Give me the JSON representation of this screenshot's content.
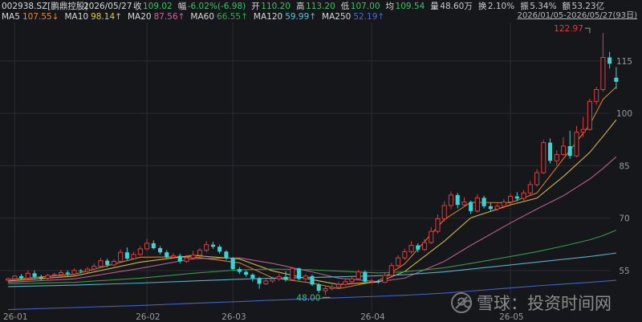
{
  "header": {
    "symbol": "002938.SZ[鹏鼎控股]",
    "date": "2026/05/27",
    "range": "2026/01/05-2026/05/27(93日)",
    "stats": [
      {
        "label": "收",
        "value": "109.02",
        "color": "#3cc06a"
      },
      {
        "label": "幅",
        "value": "-6.02%(-6.98)",
        "color": "#3cc06a"
      },
      {
        "label": "开",
        "value": "110.20",
        "color": "#3cc06a"
      },
      {
        "label": "高",
        "value": "113.20",
        "color": "#3cc06a"
      },
      {
        "label": "低",
        "value": "107.00",
        "color": "#3cc06a"
      },
      {
        "label": "均",
        "value": "109.54",
        "color": "#3cc06a"
      },
      {
        "label": "量",
        "value": "48.60万",
        "color": "#c8c8c8"
      },
      {
        "label": "换",
        "value": "2.10%",
        "color": "#c8c8c8"
      },
      {
        "label": "振",
        "value": "5.34%",
        "color": "#c8c8c8"
      },
      {
        "label": "额",
        "value": "53.23亿",
        "color": "#c8c8c8"
      }
    ],
    "ma_legend": [
      {
        "label": "MA5",
        "value": "107.55↓",
        "color": "#e8892f"
      },
      {
        "label": "MA10",
        "value": "98.14↑",
        "color": "#e2c94a"
      },
      {
        "label": "MA20",
        "value": "87.56↑",
        "color": "#c8669a"
      },
      {
        "label": "MA60",
        "value": "66.55↑",
        "color": "#3aa64e"
      },
      {
        "label": "MA120",
        "value": "59.99↑",
        "color": "#5dc0d8"
      },
      {
        "label": "MA250",
        "value": "52.19↑",
        "color": "#4a6ad8"
      }
    ]
  },
  "watermark": {
    "text": "雪球：投资时间网"
  },
  "colors": {
    "up": "#e03b3b",
    "down": "#3ad4d4",
    "grid": "#2a2c31",
    "axis_text": "#9a9a9a"
  },
  "chart_data": {
    "type": "candlestick",
    "y_ticks": [
      55,
      70,
      85,
      100,
      115
    ],
    "ylim": [
      46,
      126
    ],
    "x_tick_labels": [
      {
        "label": "26-01",
        "index": 1
      },
      {
        "label": "26-02",
        "index": 21
      },
      {
        "label": "26-03",
        "index": 34
      },
      {
        "label": "26-04",
        "index": 55
      },
      {
        "label": "26-05",
        "index": 76
      }
    ],
    "annotations": [
      {
        "text": "122.97",
        "index": 88,
        "value": 122.97,
        "color": "#e03b3b"
      },
      {
        "text": "48.00",
        "index": 48,
        "value": 48.0,
        "color": "#3cc06a"
      }
    ],
    "candles": [
      [
        52.2,
        52.6,
        53.0,
        51.6
      ],
      [
        52.6,
        53.4,
        53.6,
        52.2
      ],
      [
        53.4,
        52.8,
        54.0,
        52.4
      ],
      [
        52.8,
        54.2,
        55.0,
        52.6
      ],
      [
        54.2,
        53.2,
        55.0,
        52.8
      ],
      [
        53.2,
        52.8,
        53.8,
        52.2
      ],
      [
        52.8,
        53.6,
        54.0,
        52.4
      ],
      [
        53.6,
        53.8,
        54.4,
        53.0
      ],
      [
        53.8,
        54.4,
        55.2,
        53.2
      ],
      [
        54.4,
        54.0,
        55.0,
        53.4
      ],
      [
        54.0,
        55.0,
        55.6,
        53.6
      ],
      [
        55.0,
        54.8,
        55.4,
        54.2
      ],
      [
        54.8,
        55.4,
        56.0,
        54.4
      ],
      [
        55.4,
        56.2,
        57.0,
        55.0
      ],
      [
        56.2,
        57.8,
        58.6,
        55.8
      ],
      [
        57.8,
        56.6,
        58.4,
        56.0
      ],
      [
        56.6,
        57.6,
        58.2,
        56.2
      ],
      [
        57.6,
        60.2,
        61.0,
        57.4
      ],
      [
        60.2,
        58.4,
        61.6,
        58.0
      ],
      [
        58.4,
        59.6,
        60.4,
        58.0
      ],
      [
        59.6,
        61.2,
        62.0,
        59.2
      ],
      [
        61.2,
        62.8,
        64.0,
        60.8
      ],
      [
        62.8,
        61.4,
        63.6,
        61.0
      ],
      [
        61.4,
        60.2,
        62.0,
        59.6
      ],
      [
        60.2,
        58.8,
        60.8,
        58.2
      ],
      [
        58.8,
        59.2,
        60.0,
        58.4
      ],
      [
        59.2,
        57.6,
        59.8,
        57.0
      ],
      [
        57.6,
        58.6,
        59.4,
        57.2
      ],
      [
        58.6,
        59.4,
        60.6,
        58.0
      ],
      [
        59.4,
        60.8,
        61.4,
        58.8
      ],
      [
        60.8,
        62.4,
        63.4,
        60.2
      ],
      [
        62.4,
        61.8,
        63.2,
        61.2
      ],
      [
        61.8,
        60.4,
        62.4,
        59.8
      ],
      [
        60.4,
        58.6,
        60.8,
        58.0
      ],
      [
        58.6,
        55.4,
        58.8,
        55.0
      ],
      [
        55.4,
        54.6,
        56.0,
        54.0
      ],
      [
        54.6,
        53.8,
        55.0,
        53.2
      ],
      [
        53.8,
        52.8,
        54.2,
        51.8
      ],
      [
        52.8,
        51.2,
        53.2,
        49.8
      ],
      [
        51.2,
        52.0,
        52.6,
        50.8
      ],
      [
        52.0,
        52.6,
        53.2,
        51.4
      ],
      [
        52.6,
        53.2,
        54.0,
        52.0
      ],
      [
        53.2,
        52.4,
        54.8,
        51.8
      ],
      [
        52.4,
        55.6,
        56.0,
        52.2
      ],
      [
        55.6,
        52.6,
        55.8,
        52.2
      ],
      [
        52.6,
        53.4,
        54.0,
        52.0
      ],
      [
        53.4,
        51.0,
        53.8,
        50.6
      ],
      [
        51.0,
        49.2,
        51.4,
        48.6
      ],
      [
        49.2,
        49.8,
        50.4,
        48.0
      ],
      [
        49.8,
        50.2,
        51.0,
        49.2
      ],
      [
        50.2,
        51.0,
        51.8,
        49.8
      ],
      [
        51.0,
        51.8,
        52.4,
        50.6
      ],
      [
        51.8,
        52.6,
        53.2,
        51.2
      ],
      [
        52.6,
        54.6,
        55.2,
        52.2
      ],
      [
        54.6,
        51.8,
        55.0,
        51.4
      ],
      [
        51.8,
        52.0,
        52.6,
        51.4
      ],
      [
        52.0,
        51.6,
        52.4,
        51.2
      ],
      [
        51.6,
        53.6,
        54.4,
        51.4
      ],
      [
        53.6,
        56.4,
        57.2,
        53.2
      ],
      [
        56.4,
        58.6,
        59.4,
        56.0
      ],
      [
        58.6,
        60.4,
        61.2,
        58.0
      ],
      [
        60.4,
        62.2,
        63.4,
        59.8
      ],
      [
        62.2,
        61.0,
        62.8,
        60.2
      ],
      [
        61.0,
        63.0,
        64.0,
        60.6
      ],
      [
        63.0,
        66.2,
        67.4,
        62.6
      ],
      [
        66.2,
        69.8,
        71.0,
        65.6
      ],
      [
        69.8,
        73.6,
        74.8,
        69.0
      ],
      [
        73.6,
        76.6,
        77.6,
        72.6
      ],
      [
        76.6,
        73.8,
        77.2,
        72.8
      ],
      [
        73.8,
        74.6,
        76.0,
        73.2
      ],
      [
        74.6,
        72.0,
        75.0,
        71.2
      ],
      [
        72.0,
        75.8,
        76.8,
        71.6
      ],
      [
        75.8,
        73.4,
        76.4,
        72.8
      ],
      [
        73.4,
        72.6,
        74.4,
        71.8
      ],
      [
        72.6,
        73.4,
        74.2,
        72.0
      ],
      [
        73.4,
        74.6,
        75.4,
        72.8
      ],
      [
        74.6,
        76.2,
        77.0,
        74.0
      ],
      [
        76.2,
        75.6,
        77.4,
        74.8
      ],
      [
        75.6,
        77.2,
        78.0,
        75.0
      ],
      [
        77.2,
        79.6,
        80.6,
        76.6
      ],
      [
        79.6,
        83.0,
        84.0,
        79.0
      ],
      [
        83.0,
        91.6,
        92.4,
        82.6
      ],
      [
        91.6,
        86.4,
        92.8,
        85.6
      ],
      [
        86.4,
        88.2,
        89.4,
        85.2
      ],
      [
        88.2,
        90.6,
        93.2,
        87.8
      ],
      [
        90.6,
        87.8,
        95.0,
        87.0
      ],
      [
        87.8,
        94.6,
        96.4,
        87.4
      ],
      [
        94.6,
        95.4,
        99.0,
        93.2
      ],
      [
        95.4,
        103.4,
        104.2,
        95.0
      ],
      [
        103.4,
        106.8,
        107.6,
        102.4
      ],
      [
        106.8,
        116.0,
        122.97,
        106.2
      ],
      [
        116.0,
        114.2,
        117.6,
        112.8
      ],
      [
        110.2,
        109.02,
        113.2,
        107.0
      ]
    ],
    "ma_lines": [
      {
        "name": "MA5",
        "color": "#e8892f",
        "values": [
          [
            0,
            52.4
          ],
          [
            10,
            53.9
          ],
          [
            20,
            58.8
          ],
          [
            28,
            58.9
          ],
          [
            35,
            57.2
          ],
          [
            40,
            52.9
          ],
          [
            46,
            51.4
          ],
          [
            50,
            49.8
          ],
          [
            56,
            52.0
          ],
          [
            60,
            56.9
          ],
          [
            66,
            69.6
          ],
          [
            70,
            74.5
          ],
          [
            76,
            74.4
          ],
          [
            80,
            77.2
          ],
          [
            84,
            87.0
          ],
          [
            88,
            96.7
          ],
          [
            90,
            104.0
          ],
          [
            92,
            107.55
          ]
        ]
      },
      {
        "name": "MA10",
        "color": "#e2c94a",
        "values": [
          [
            0,
            52.0
          ],
          [
            10,
            53.4
          ],
          [
            20,
            57.4
          ],
          [
            28,
            59.3
          ],
          [
            35,
            58.3
          ],
          [
            40,
            54.9
          ],
          [
            46,
            52.4
          ],
          [
            50,
            51.0
          ],
          [
            56,
            51.7
          ],
          [
            60,
            54.7
          ],
          [
            66,
            63.4
          ],
          [
            70,
            70.1
          ],
          [
            76,
            73.8
          ],
          [
            80,
            75.7
          ],
          [
            84,
            81.9
          ],
          [
            88,
            88.8
          ],
          [
            90,
            93.4
          ],
          [
            92,
            98.14
          ]
        ]
      },
      {
        "name": "MA20",
        "color": "#c8669a",
        "values": [
          [
            0,
            51.6
          ],
          [
            10,
            52.6
          ],
          [
            20,
            55.6
          ],
          [
            28,
            58.4
          ],
          [
            35,
            58.6
          ],
          [
            40,
            57.0
          ],
          [
            46,
            54.6
          ],
          [
            50,
            52.8
          ],
          [
            56,
            51.8
          ],
          [
            60,
            52.8
          ],
          [
            66,
            57.6
          ],
          [
            70,
            62.2
          ],
          [
            76,
            68.6
          ],
          [
            80,
            72.6
          ],
          [
            84,
            76.4
          ],
          [
            88,
            81.2
          ],
          [
            90,
            84.2
          ],
          [
            92,
            87.56
          ]
        ]
      },
      {
        "name": "MA60",
        "color": "#3aa64e",
        "values": [
          [
            0,
            51.2
          ],
          [
            10,
            51.6
          ],
          [
            20,
            52.8
          ],
          [
            28,
            54.2
          ],
          [
            35,
            55.2
          ],
          [
            40,
            55.4
          ],
          [
            46,
            55.2
          ],
          [
            50,
            54.8
          ],
          [
            56,
            54.3
          ],
          [
            60,
            54.6
          ],
          [
            66,
            55.8
          ],
          [
            70,
            57.0
          ],
          [
            76,
            59.0
          ],
          [
            80,
            60.4
          ],
          [
            84,
            62.0
          ],
          [
            88,
            63.8
          ],
          [
            90,
            65.0
          ],
          [
            92,
            66.55
          ]
        ]
      },
      {
        "name": "MA120",
        "color": "#5dc0d8",
        "values": [
          [
            0,
            50.4
          ],
          [
            10,
            50.8
          ],
          [
            20,
            51.4
          ],
          [
            28,
            52.0
          ],
          [
            35,
            52.5
          ],
          [
            40,
            52.8
          ],
          [
            46,
            53.0
          ],
          [
            50,
            53.2
          ],
          [
            56,
            53.5
          ],
          [
            60,
            53.8
          ],
          [
            66,
            54.6
          ],
          [
            70,
            55.4
          ],
          [
            76,
            56.6
          ],
          [
            80,
            57.4
          ],
          [
            84,
            58.2
          ],
          [
            88,
            59.0
          ],
          [
            90,
            59.5
          ],
          [
            92,
            59.99
          ]
        ]
      },
      {
        "name": "MA250",
        "color": "#4a6ad8",
        "values": [
          [
            0,
            43.8
          ],
          [
            10,
            44.4
          ],
          [
            20,
            45.0
          ],
          [
            28,
            45.6
          ],
          [
            35,
            46.1
          ],
          [
            40,
            46.5
          ],
          [
            46,
            46.9
          ],
          [
            50,
            47.2
          ],
          [
            56,
            47.6
          ],
          [
            60,
            47.9
          ],
          [
            66,
            48.5
          ],
          [
            70,
            49.1
          ],
          [
            76,
            50.0
          ],
          [
            80,
            50.6
          ],
          [
            84,
            51.1
          ],
          [
            88,
            51.6
          ],
          [
            90,
            51.9
          ],
          [
            92,
            52.19
          ]
        ]
      }
    ]
  }
}
